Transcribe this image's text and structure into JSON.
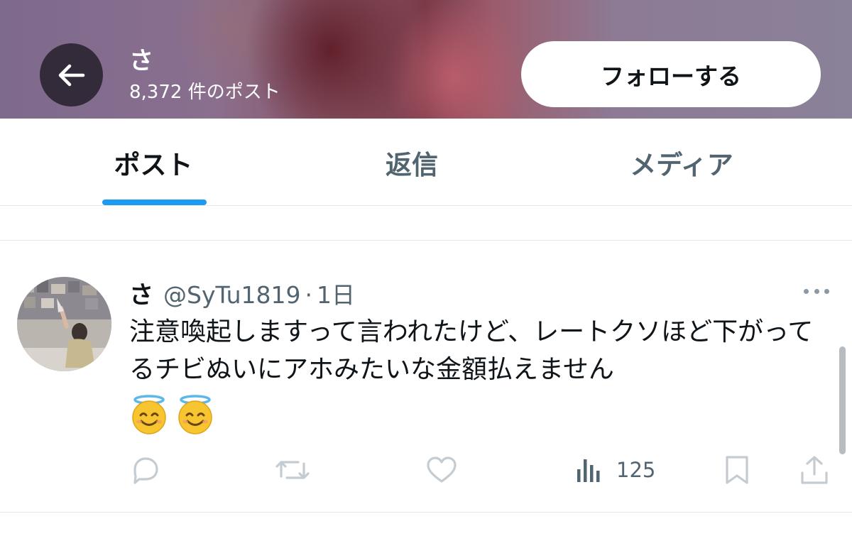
{
  "header": {
    "name": "さ",
    "post_count": "8,372 件のポスト",
    "follow_label": "フォローする"
  },
  "tabs": [
    {
      "label": "ポスト",
      "active": true
    },
    {
      "label": "返信",
      "active": false
    },
    {
      "label": "メディア",
      "active": false
    }
  ],
  "post": {
    "display_name": "さ",
    "handle": "@SyTu1819",
    "separator": "·",
    "time": "1日",
    "text": "注意喚起しますって言われたけど、レートクソほど下がってるチビぬいにアホみたいな金額払えません",
    "emojis": [
      "smiling-face-with-halo",
      "smiling-face-with-halo"
    ],
    "views": "125"
  },
  "colors": {
    "accent": "#1d9bf0",
    "text_primary": "#0f1419",
    "text_secondary": "#536471",
    "icon": "#8b98a5"
  },
  "icons": [
    "back-arrow-icon",
    "more-icon",
    "reply-icon",
    "repost-icon",
    "like-icon",
    "views-icon",
    "bookmark-icon",
    "share-icon"
  ]
}
